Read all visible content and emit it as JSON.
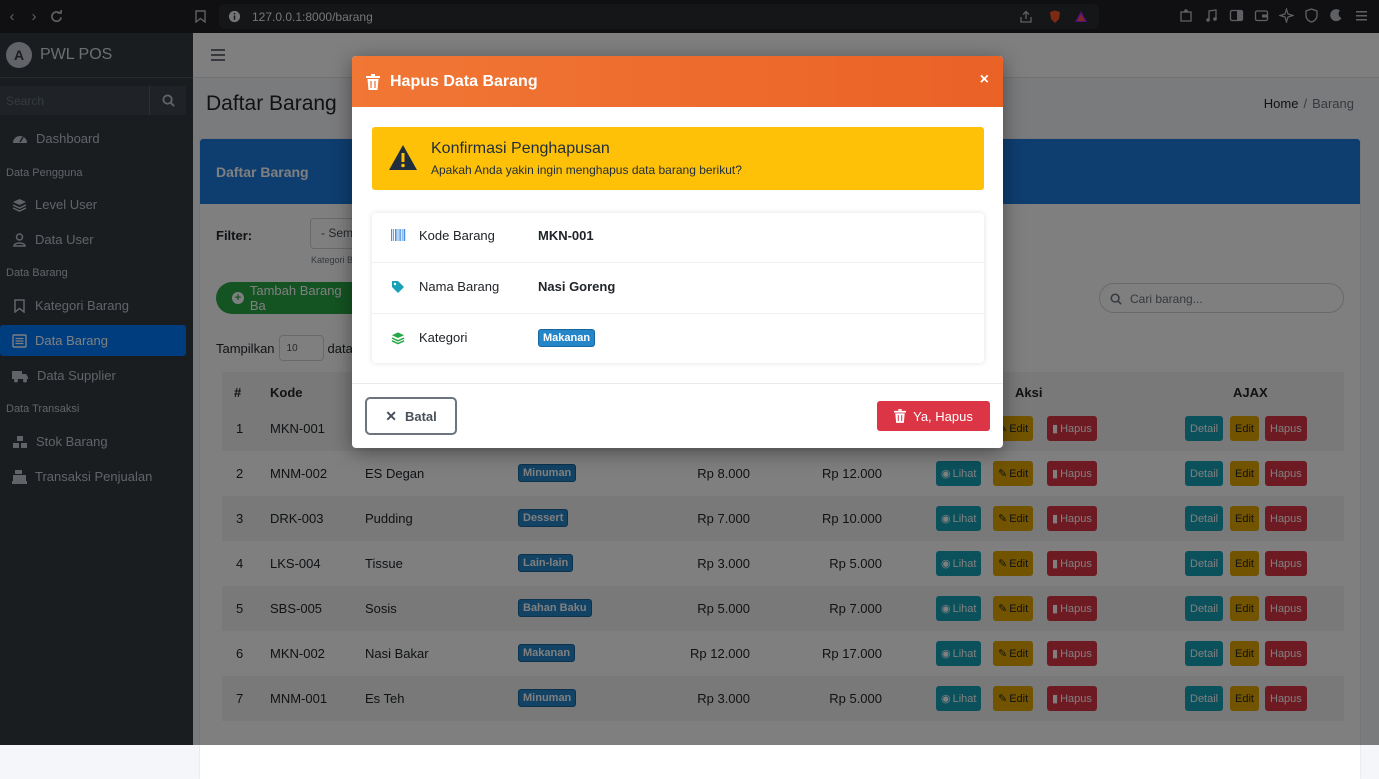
{
  "browser": {
    "url": "127.0.0.1:8000/barang"
  },
  "sidebar": {
    "brand": "PWL POS",
    "search_placeholder": "Search",
    "items": [
      {
        "label": "Dashboard"
      },
      {
        "header": "Data Pengguna"
      },
      {
        "label": "Level User"
      },
      {
        "label": "Data User"
      },
      {
        "header": "Data Barang"
      },
      {
        "label": "Kategori Barang"
      },
      {
        "label": "Data Barang",
        "active": true
      },
      {
        "label": "Data Supplier"
      },
      {
        "header": "Data Transaksi"
      },
      {
        "label": "Stok Barang"
      },
      {
        "label": "Transaksi Penjualan"
      }
    ]
  },
  "page": {
    "title": "Daftar Barang",
    "breadcrumb": [
      "Home",
      "Barang"
    ],
    "card_title": "Daftar Barang",
    "filter_label": "Filter:",
    "filter_value": "- Sem",
    "filter_hint": "Kategori B",
    "add_button": "Tambah Barang Ba",
    "search_placeholder": "Cari barang...",
    "show_prefix": "Tampilkan",
    "show_value": "10",
    "show_suffix": "data p"
  },
  "table": {
    "headers": {
      "no": "#",
      "kode": "Kode",
      "aksi": "Aksi",
      "ajax": "AJAX"
    },
    "rows": [
      {
        "no": "1",
        "kode": "MKN-001",
        "nama": "",
        "kategori": "",
        "beli": "",
        "jual": ""
      },
      {
        "no": "2",
        "kode": "MNM-002",
        "nama": "ES Degan",
        "kategori": "Minuman",
        "beli": "Rp 8.000",
        "jual": "Rp 12.000"
      },
      {
        "no": "3",
        "kode": "DRK-003",
        "nama": "Pudding",
        "kategori": "Dessert",
        "beli": "Rp 7.000",
        "jual": "Rp 10.000"
      },
      {
        "no": "4",
        "kode": "LKS-004",
        "nama": "Tissue",
        "kategori": "Lain-lain",
        "beli": "Rp 3.000",
        "jual": "Rp 5.000"
      },
      {
        "no": "5",
        "kode": "SBS-005",
        "nama": "Sosis",
        "kategori": "Bahan Baku",
        "beli": "Rp 5.000",
        "jual": "Rp 7.000"
      },
      {
        "no": "6",
        "kode": "MKN-002",
        "nama": "Nasi Bakar",
        "kategori": "Makanan",
        "beli": "Rp 12.000",
        "jual": "Rp 17.000"
      },
      {
        "no": "7",
        "kode": "MNM-001",
        "nama": "Es Teh",
        "kategori": "Minuman",
        "beli": "Rp 3.000",
        "jual": "Rp 5.000"
      }
    ],
    "actions": {
      "lihat": "Lihat",
      "edit": "Edit",
      "hapus": "Hapus",
      "detail": "Detail"
    }
  },
  "modal": {
    "title": "Hapus Data Barang",
    "close": "×",
    "alert_title": "Konfirmasi Penghapusan",
    "alert_message": "Apakah Anda yakin ingin menghapus data barang berikut?",
    "fields": [
      {
        "label": "Kode Barang",
        "value": "MKN-001",
        "icon": "barcode-icon"
      },
      {
        "label": "Nama Barang",
        "value": "Nasi Goreng",
        "icon": "tag-icon"
      },
      {
        "label": "Kategori",
        "value": "Makanan",
        "icon": "layers-icon"
      }
    ],
    "cancel_label": "Batal",
    "confirm_label": "Ya, Hapus"
  },
  "colors": {
    "modal_header": "#f06a2d",
    "alert": "#ffc107",
    "danger": "#dc3545",
    "primary": "#007bff",
    "sidebar": "#343a40"
  }
}
